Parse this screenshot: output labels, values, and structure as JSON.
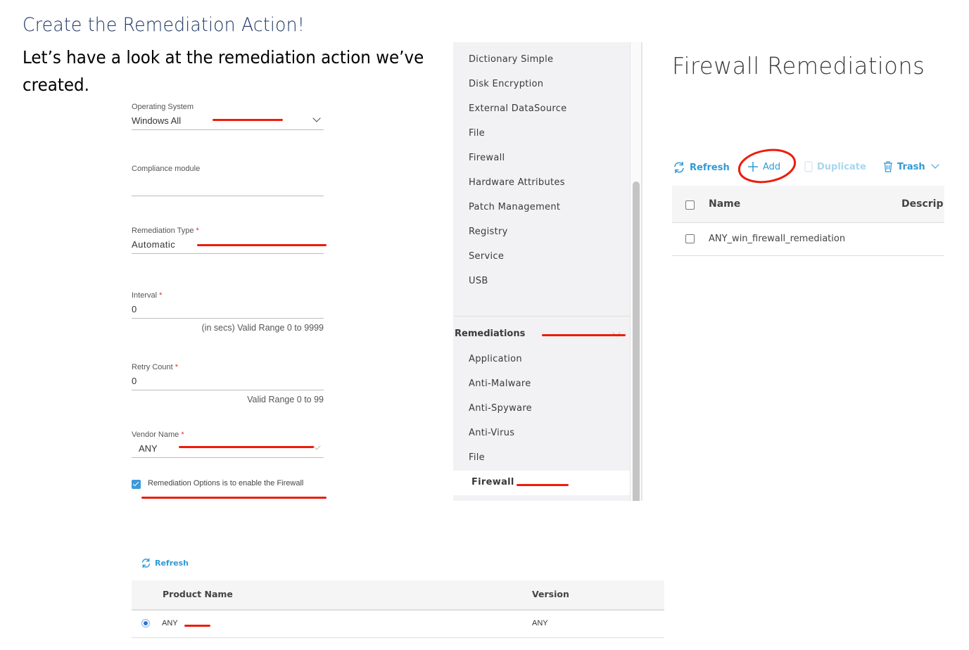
{
  "document": {
    "heading": "Create the Remediation Action!",
    "body": "Let’s have a look at the remediation action we’ve created."
  },
  "form": {
    "operating_system": {
      "label": "Operating System",
      "value": "Windows All"
    },
    "compliance_module": {
      "label": "Compliance module",
      "value": ""
    },
    "remediation_type": {
      "label": "Remediation Type",
      "required_mark": "*",
      "value": "Automatic"
    },
    "interval": {
      "label": "Interval",
      "required_mark": "*",
      "value": "0",
      "hint": "(in secs) Valid Range 0 to 9999"
    },
    "retry_count": {
      "label": "Retry Count",
      "required_mark": "*",
      "value": "0",
      "hint": "Valid Range 0 to 99"
    },
    "vendor_name": {
      "label": "Vendor Name",
      "required_mark": "*",
      "value": "ANY"
    },
    "remediation_option": {
      "label": "Remediation Options is to enable the Firewall",
      "checked": true
    }
  },
  "sidebar": {
    "conditions": [
      "Dictionary Simple",
      "Disk Encryption",
      "External DataSource",
      "File",
      "Firewall",
      "Hardware Attributes",
      "Patch Management",
      "Registry",
      "Service",
      "USB"
    ],
    "section_title": "Remediations",
    "remediations": [
      "Application",
      "Anti-Malware",
      "Anti-Spyware",
      "Anti-Virus",
      "File",
      "Firewall"
    ],
    "selected": "Firewall"
  },
  "firewall_remediations": {
    "title": "Firewall Remediations",
    "toolbar": {
      "refresh": "Refresh",
      "add": "Add",
      "duplicate": "Duplicate",
      "trash": "Trash"
    },
    "columns": [
      "Name",
      "Descrip"
    ],
    "rows": [
      {
        "name": "ANY_win_firewall_remediation",
        "description": ""
      }
    ]
  },
  "product_table": {
    "refresh": "Refresh",
    "columns": [
      "Product Name",
      "Version"
    ],
    "rows": [
      {
        "product_name": "ANY",
        "version": "ANY",
        "selected": true
      }
    ]
  },
  "annotation_color": "#ee1c0c",
  "accent_color": "#2f9bd6"
}
